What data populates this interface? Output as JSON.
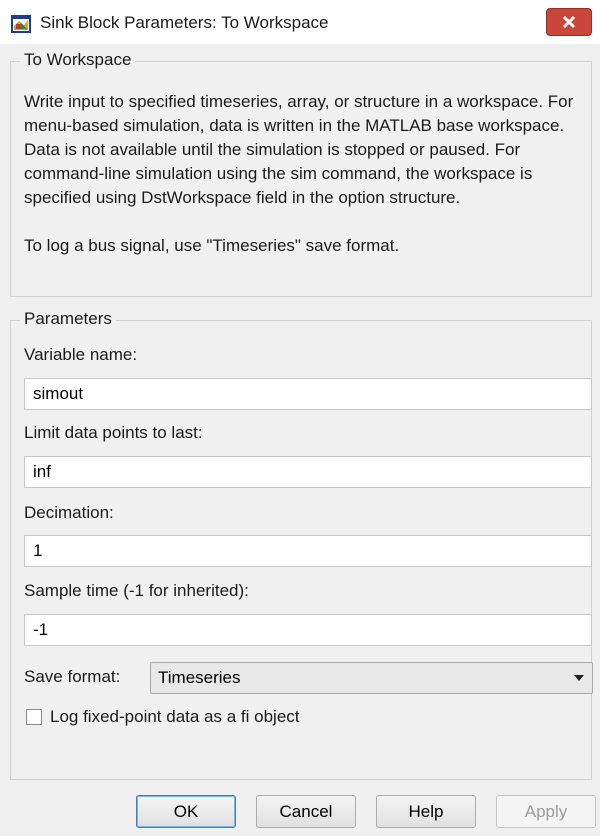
{
  "window": {
    "title": "Sink Block Parameters: To Workspace",
    "icon": "simulink-block-icon",
    "close_icon": "close-icon"
  },
  "block_group": {
    "caption": "To Workspace",
    "description": "Write input to specified timeseries, array, or structure in a workspace. For menu-based simulation, data is written in the MATLAB base workspace. Data is not available until the simulation is stopped or paused. For command-line simulation using the sim command, the workspace is specified using DstWorkspace field in the option structure.",
    "note": "To log a bus signal, use \"Timeseries\" save format."
  },
  "parameters": {
    "caption": "Parameters",
    "variable_name": {
      "label": "Variable name:",
      "value": "simout"
    },
    "limit_points": {
      "label": "Limit data points to last:",
      "value": "inf"
    },
    "decimation": {
      "label": "Decimation:",
      "value": "1"
    },
    "sample_time": {
      "label": "Sample time (-1 for inherited):",
      "value": "-1"
    },
    "save_format": {
      "label": "Save format:",
      "value": "Timeseries"
    },
    "log_fixed_point": {
      "label": "Log fixed-point data as a fi object",
      "checked": false
    }
  },
  "buttons": {
    "ok": "OK",
    "cancel": "Cancel",
    "help": "Help",
    "apply": "Apply"
  }
}
